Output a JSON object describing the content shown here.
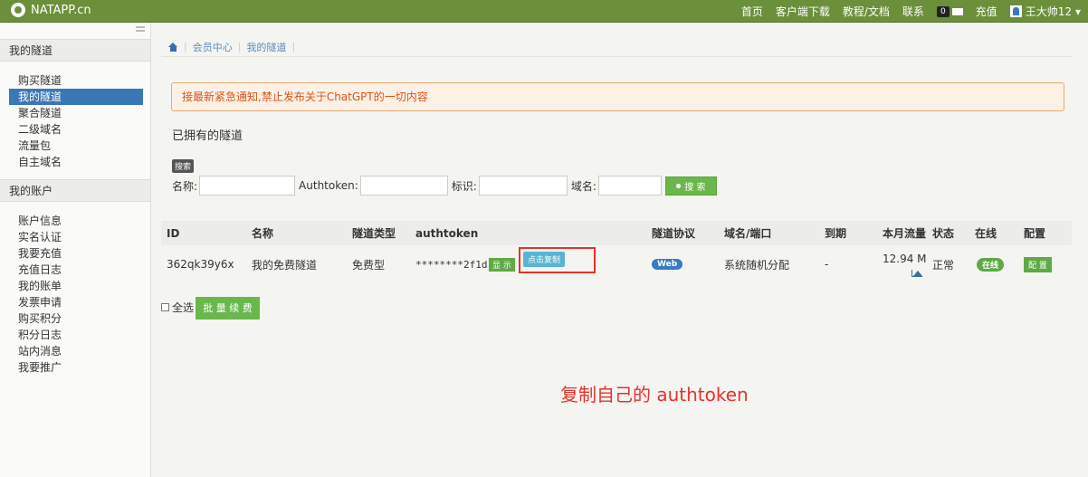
{
  "topbar": {
    "brand": "NATAPP.cn",
    "nav": [
      "首页",
      "客户端下载",
      "教程/文档",
      "联系"
    ],
    "msg_count": "0",
    "recharge": "充值",
    "username": "王大帅12"
  },
  "sidebar": {
    "section1_title": "我的隧道",
    "section1_items": [
      "购买隧道",
      "我的隧道",
      "聚合隧道",
      "二级域名",
      "流量包",
      "自主域名"
    ],
    "active_index": 1,
    "section2_title": "我的账户",
    "section2_items": [
      "账户信息",
      "实名认证",
      "我要充值",
      "充值日志",
      "我的账单",
      "发票申请",
      "购买积分",
      "积分日志",
      "站内消息",
      "我要推广"
    ]
  },
  "breadcrumb": [
    "会员中心",
    "我的隧道"
  ],
  "notice": "接最新紧急通知,禁止发布关于ChatGPT的一切内容",
  "section_title": "已拥有的隧道",
  "search": {
    "badge": "搜索",
    "name_label": "名称:",
    "authtoken_label": "Authtoken:",
    "tag_label": "标识:",
    "domain_label": "域名:",
    "button": "搜 索"
  },
  "table": {
    "headers": [
      "ID",
      "名称",
      "隧道类型",
      "authtoken",
      "隧道协议",
      "域名/端口",
      "到期",
      "本月流量",
      "状态",
      "在线",
      "配置"
    ],
    "rows": [
      {
        "id": "362qk39y6x",
        "name": "我的免费隧道",
        "type": "免费型",
        "authtoken": "********2f1d",
        "show_btn": "显 示",
        "copy_btn": "点击复制",
        "protocol": "Web",
        "domain": "系统随机分配",
        "expire": "-",
        "traffic": "12.94 M",
        "status": "正常",
        "online": "在线",
        "config": "配 置"
      }
    ]
  },
  "select_all": "全选",
  "batch_renew": "批 量 续 费",
  "annotation": "复制自己的 authtoken"
}
